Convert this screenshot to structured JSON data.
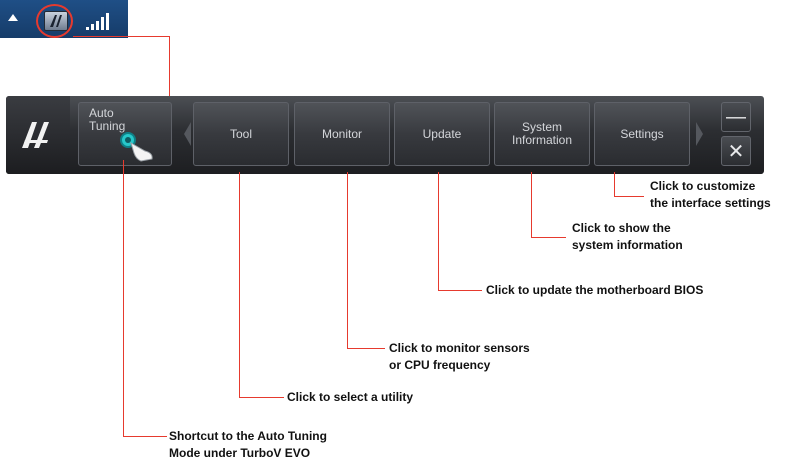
{
  "toolbar": {
    "auto_tuning_label": "Auto\nTuning",
    "tool_label": "Tool",
    "monitor_label": "Monitor",
    "update_label": "Update",
    "system_info_label": "System\nInformation",
    "settings_label": "Settings",
    "minimize_label": "—",
    "close_label": "✕"
  },
  "callouts": {
    "settings": "Click to customize\nthe interface settings",
    "system_info": "Click to show the\nsystem information",
    "update": "Click to update the motherboard BIOS",
    "monitor": "Click to monitor sensors\nor CPU frequency",
    "tool": "Click to select a utility",
    "auto_tuning": "Shortcut to the Auto Tuning\nMode under TurboV EVO"
  },
  "icons": {
    "tray_expand": "up-arrow-icon",
    "tray_app": "ai-suite-tray-icon",
    "tray_signal": "signal-bars-icon",
    "logo": "ai-suite-logo-icon",
    "auto_tuning": "hand-pointer-icon",
    "minimize": "minimize-icon",
    "close": "close-icon"
  },
  "colors": {
    "callout_line": "#e63a2e",
    "toolbar_bg": "#2c2e32",
    "tray_bg": "#1f4f86",
    "accent_cyan": "#27c7c9"
  }
}
